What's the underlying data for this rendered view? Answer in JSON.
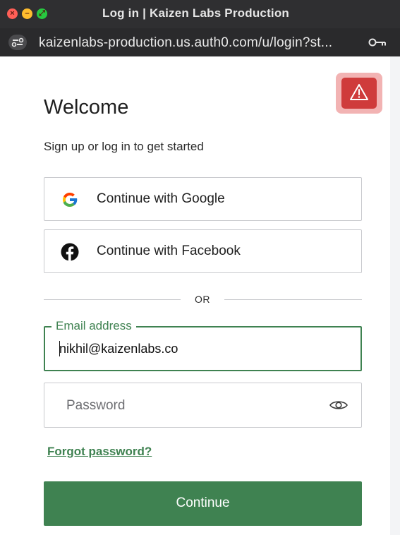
{
  "window": {
    "title": "Log in | Kaizen Labs Production"
  },
  "browser": {
    "url": "kaizenlabs-production.us.auth0.com/u/login?st..."
  },
  "page": {
    "heading": "Welcome",
    "subtitle": "Sign up or log in to get started",
    "google_label": "Continue with Google",
    "facebook_label": "Continue with Facebook",
    "divider_text": "OR",
    "email": {
      "label": "Email address",
      "value": "nikhil@kaizenlabs.co"
    },
    "password": {
      "placeholder": "Password"
    },
    "forgot_label": "Forgot password?",
    "continue_label": "Continue"
  },
  "icons": {
    "alert": "warning-triangle-icon",
    "google": "google-icon",
    "facebook": "facebook-icon",
    "eye": "eye-icon",
    "key": "key-icon"
  },
  "colors": {
    "accent": "#3f8251",
    "alert": "#cf3b3b",
    "titlebar": "#2f2f31"
  }
}
